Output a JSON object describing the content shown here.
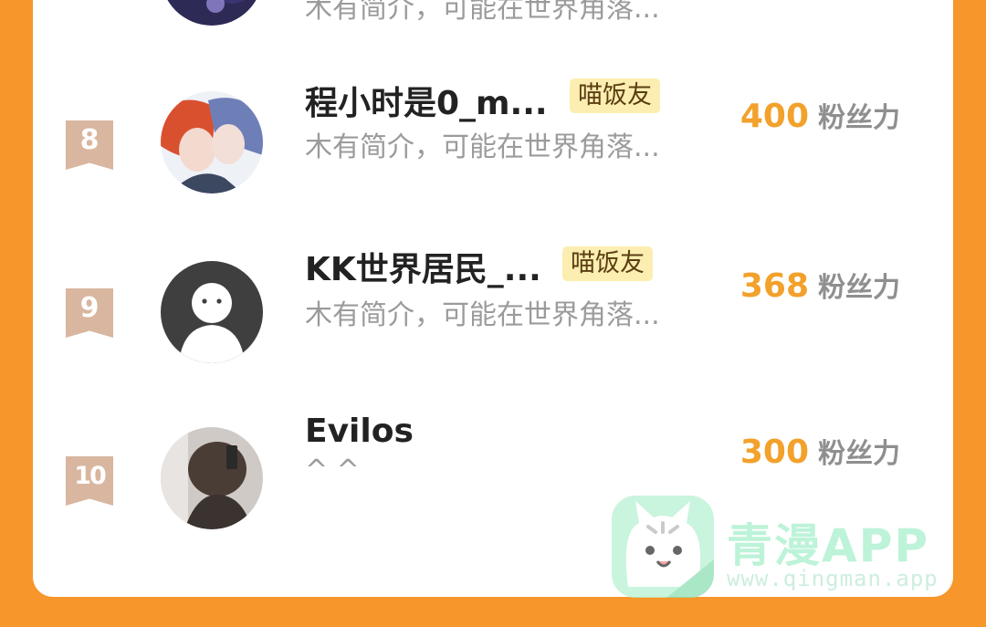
{
  "rows": [
    {
      "rank": "",
      "name": "",
      "badge": "",
      "intro": "木有简介，可能在世界角落...",
      "fans_num": "",
      "fans_unit": ""
    },
    {
      "rank": "8",
      "name": "程小时是0_m...",
      "badge": "喵饭友",
      "intro": "木有简介，可能在世界角落...",
      "fans_num": "400",
      "fans_unit": "粉丝力"
    },
    {
      "rank": "9",
      "name": "KK世界居民_...",
      "badge": "喵饭友",
      "intro": "木有简介，可能在世界角落...",
      "fans_num": "368",
      "fans_unit": "粉丝力"
    },
    {
      "rank": "10",
      "name": "Evilos",
      "badge": "",
      "intro": "^ ^",
      "fans_num": "300",
      "fans_unit": "粉丝力"
    }
  ],
  "watermark": {
    "title": "青漫APP",
    "url": "www.qingman.app"
  },
  "colors": {
    "background": "#f7962a",
    "fans_number": "#f2a12b",
    "badge_bg": "#fbeeb0",
    "rank_ribbon": "#d8b69f"
  }
}
